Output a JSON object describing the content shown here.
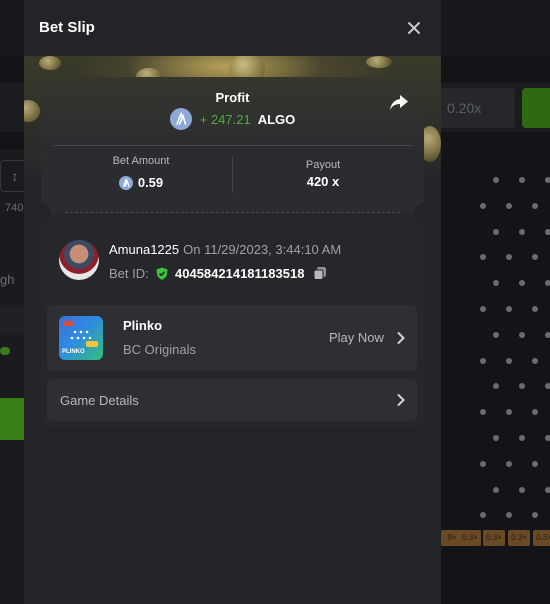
{
  "background": {
    "chip_value": "0.20x",
    "left_box_glyph": "↕",
    "left_value": "740",
    "left_label": "gh",
    "multipliers": [
      "9×",
      "0.3×",
      "0.3×",
      "0.3×",
      "0.3×"
    ]
  },
  "modal": {
    "title": "Bet Slip",
    "close_icon": "close-icon",
    "profit": {
      "label": "Profit",
      "amount": "+ 247.21",
      "currency": "ALGO",
      "share_icon": "share-icon"
    },
    "stats": {
      "bet_amount_label": "Bet Amount",
      "bet_amount_value": "0.59",
      "payout_label": "Payout",
      "payout_value": "420 x"
    },
    "user": {
      "name": "Amuna1225",
      "date": "On 11/29/2023, 3:44:10 AM",
      "bet_id_label": "Bet ID:",
      "bet_id": "404584214181183518"
    },
    "game": {
      "name": "Plinko",
      "provider": "BC Originals",
      "thumb_label": "PLINKO",
      "play_label": "Play Now"
    },
    "details": {
      "label": "Game Details"
    }
  },
  "colors": {
    "profit_green": "#4caf3a",
    "modal_bg": "#232428",
    "card_bg": "#26272b",
    "shield_green": "#3bc33b"
  }
}
